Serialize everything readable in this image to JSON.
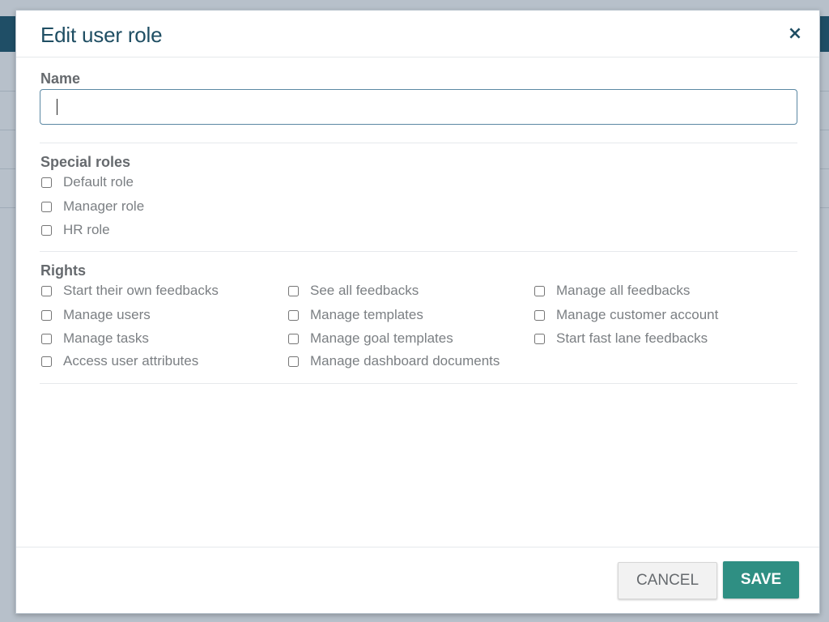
{
  "modal": {
    "title": "Edit user role",
    "close_icon": "close-icon",
    "close_glyph": "×"
  },
  "name_field": {
    "label": "Name",
    "value": "",
    "placeholder": ""
  },
  "special_roles": {
    "label": "Special roles",
    "items": [
      {
        "label": "Default role",
        "checked": false
      },
      {
        "label": "Manager role",
        "checked": false
      },
      {
        "label": "HR role",
        "checked": false
      }
    ]
  },
  "rights": {
    "label": "Rights",
    "items": [
      {
        "label": "Start their own feedbacks",
        "checked": false
      },
      {
        "label": "Manage users",
        "checked": false
      },
      {
        "label": "Manage tasks",
        "checked": false
      },
      {
        "label": "Access user attributes",
        "checked": false
      },
      {
        "label": "See all feedbacks",
        "checked": false
      },
      {
        "label": "Manage templates",
        "checked": false
      },
      {
        "label": "Manage goal templates",
        "checked": false
      },
      {
        "label": "Manage dashboard documents",
        "checked": false
      },
      {
        "label": "Manage all feedbacks",
        "checked": false
      },
      {
        "label": "Manage customer account",
        "checked": false
      },
      {
        "label": "Start fast lane feedbacks",
        "checked": false
      }
    ]
  },
  "footer": {
    "cancel_label": "CANCEL",
    "save_label": "SAVE"
  },
  "colors": {
    "title": "#1f4e63",
    "save_button": "#2f8f83",
    "input_border": "#5b88a3",
    "label_text": "#7b7f83"
  }
}
